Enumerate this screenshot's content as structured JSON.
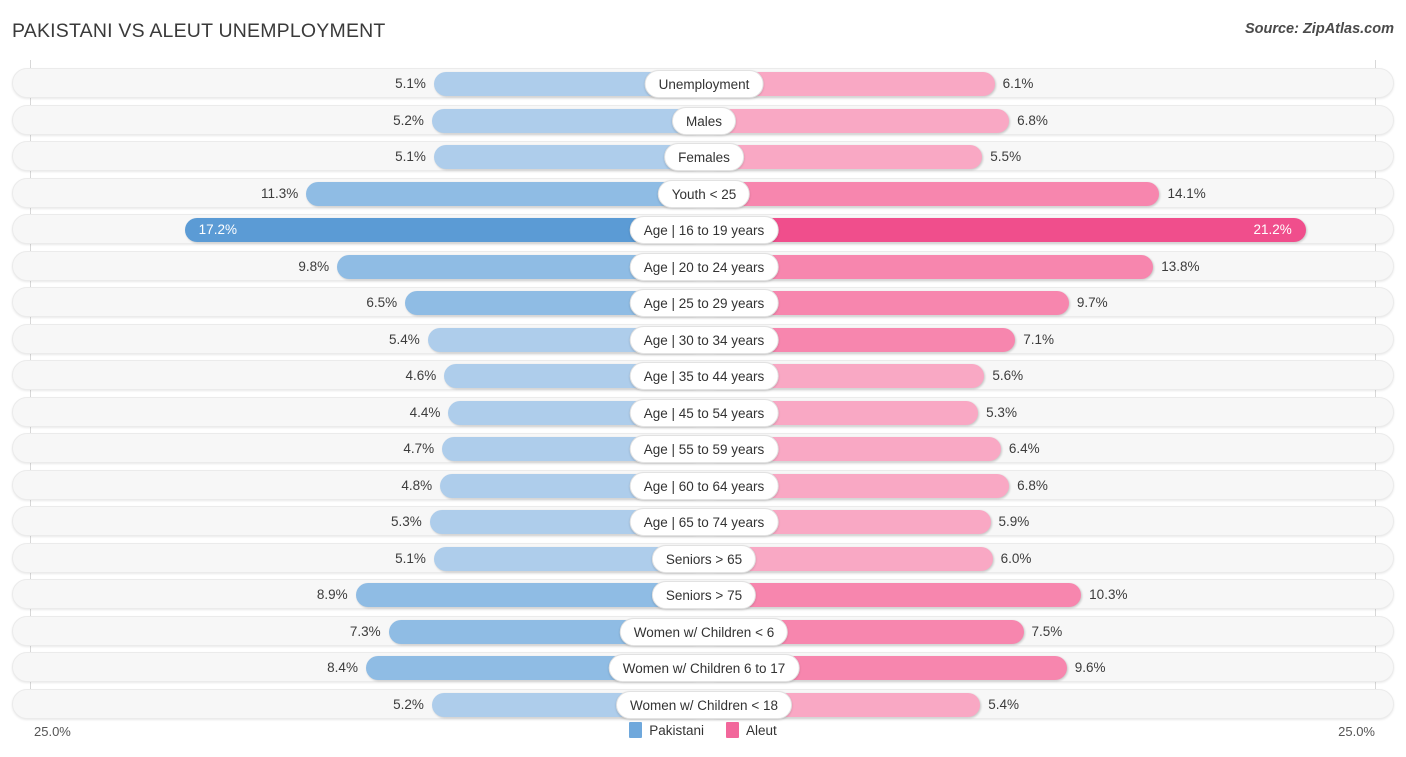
{
  "header": {
    "title": "PAKISTANI VS ALEUT UNEMPLOYMENT",
    "source": "Source: ZipAtlas.com"
  },
  "axis": {
    "left_label": "25.0%",
    "right_label": "25.0%",
    "max": 25.0
  },
  "legend": {
    "items": [
      {
        "label": "Pakistani",
        "color": "#6fa8dc"
      },
      {
        "label": "Aleut",
        "color": "#f2679b"
      }
    ]
  },
  "colors": {
    "left_light": "#aecdeb",
    "left_mid": "#8fbce4",
    "left_dark": "#5b9bd5",
    "right_light": "#f9a8c4",
    "right_mid": "#f786ae",
    "right_dark": "#f04e8c",
    "track": "#f7f7f7",
    "gridline": "#d8d8d8"
  },
  "chart_data": {
    "type": "bar",
    "title": "PAKISTANI VS ALEUT UNEMPLOYMENT",
    "subtitle": "",
    "xlabel": "",
    "ylabel": "",
    "orientation": "horizontal-diverging",
    "axis_max": 25.0,
    "grid": true,
    "legend_position": "bottom-center",
    "categories": [
      "Unemployment",
      "Males",
      "Females",
      "Youth < 25",
      "Age | 16 to 19 years",
      "Age | 20 to 24 years",
      "Age | 25 to 29 years",
      "Age | 30 to 34 years",
      "Age | 35 to 44 years",
      "Age | 45 to 54 years",
      "Age | 55 to 59 years",
      "Age | 60 to 64 years",
      "Age | 65 to 74 years",
      "Seniors > 65",
      "Seniors > 75",
      "Women w/ Children < 6",
      "Women w/ Children 6 to 17",
      "Women w/ Children < 18"
    ],
    "series": [
      {
        "name": "Pakistani",
        "color": "#6fa8dc",
        "values": [
          5.1,
          5.2,
          5.1,
          11.3,
          17.2,
          9.8,
          6.5,
          5.4,
          4.6,
          4.4,
          4.7,
          4.8,
          5.3,
          5.1,
          8.9,
          7.3,
          8.4,
          5.2
        ],
        "labels": [
          "5.1%",
          "5.2%",
          "5.1%",
          "11.3%",
          "17.2%",
          "9.8%",
          "6.5%",
          "5.4%",
          "4.6%",
          "4.4%",
          "4.7%",
          "4.8%",
          "5.3%",
          "5.1%",
          "8.9%",
          "7.3%",
          "8.4%",
          "5.2%"
        ]
      },
      {
        "name": "Aleut",
        "color": "#f2679b",
        "values": [
          6.1,
          6.8,
          5.5,
          14.1,
          21.2,
          13.8,
          9.7,
          7.1,
          5.6,
          5.3,
          6.4,
          6.8,
          5.9,
          6.0,
          10.3,
          7.5,
          9.6,
          5.4
        ],
        "labels": [
          "6.1%",
          "6.8%",
          "5.5%",
          "14.1%",
          "21.2%",
          "13.8%",
          "9.7%",
          "7.1%",
          "5.6%",
          "5.3%",
          "6.4%",
          "6.8%",
          "5.9%",
          "6.0%",
          "10.3%",
          "7.5%",
          "9.6%",
          "5.4%"
        ]
      }
    ]
  }
}
